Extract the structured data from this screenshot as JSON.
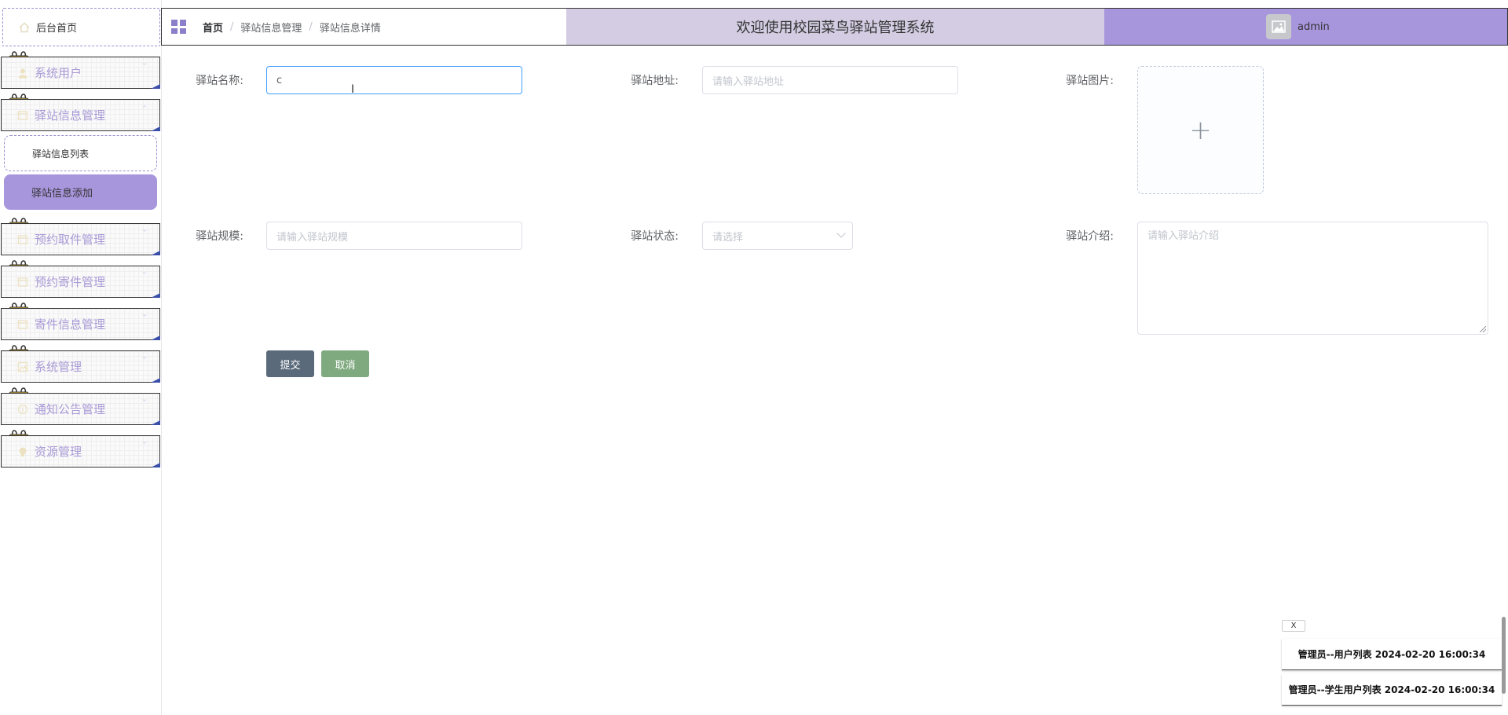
{
  "sidebar": {
    "home_label": "后台首页",
    "menus": [
      {
        "label": "系统用户",
        "icon": "user-icon"
      },
      {
        "label": "驿站信息管理",
        "icon": "folder-icon"
      },
      {
        "label": "预约取件管理",
        "icon": "folder-icon"
      },
      {
        "label": "预约寄件管理",
        "icon": "folder-icon"
      },
      {
        "label": "寄件信息管理",
        "icon": "folder-icon"
      },
      {
        "label": "系统管理",
        "icon": "picture-icon"
      },
      {
        "label": "通知公告管理",
        "icon": "info-icon"
      },
      {
        "label": "资源管理",
        "icon": "bulb-icon"
      }
    ],
    "submenu": {
      "list_label": "驿站信息列表",
      "add_label": "驿站信息添加"
    },
    "accent_color": "#a896dd"
  },
  "header": {
    "breadcrumb": [
      "首页",
      "驿站信息管理",
      "驿站信息详情"
    ],
    "title": "欢迎使用校园菜鸟驿站管理系统",
    "username": "admin"
  },
  "form": {
    "name": {
      "label": "驿站名称:",
      "value": "c"
    },
    "address": {
      "label": "驿站地址:",
      "placeholder": "请输入驿站地址"
    },
    "image": {
      "label": "驿站图片:",
      "upload_symbol": "+"
    },
    "scale": {
      "label": "驿站规模:",
      "placeholder": "请输入驿站规模"
    },
    "status": {
      "label": "驿站状态:",
      "placeholder": "请选择"
    },
    "intro": {
      "label": "驿站介绍:",
      "placeholder": "请输入驿站介绍"
    },
    "submit_label": "提交",
    "cancel_label": "取消"
  },
  "notifications": {
    "close_label": "X",
    "items": [
      "管理员--用户列表 2024-02-20 16:00:34",
      "管理员--学生用户列表 2024-02-20 16:00:34"
    ]
  }
}
